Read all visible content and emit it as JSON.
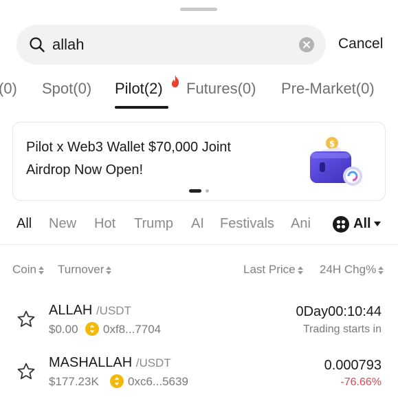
{
  "search": {
    "value": "allah",
    "cancel_label": "Cancel"
  },
  "tabs": [
    {
      "label": "(0)"
    },
    {
      "label": "Spot(0)"
    },
    {
      "label": "Pilot(2)",
      "active": true
    },
    {
      "label": "Futures(0)"
    },
    {
      "label": "Pre-Market(0)"
    }
  ],
  "banner": {
    "line1": "Pilot x Web3 Wallet $70,000 Joint",
    "line2": "Airdrop Now Open!"
  },
  "filters": {
    "items": [
      "All",
      "New",
      "Hot",
      "Trump",
      "AI",
      "Festivals",
      "Ani"
    ],
    "dropdown_label": "All"
  },
  "table": {
    "headers": {
      "coin": "Coin",
      "turnover": "Turnover",
      "last_price": "Last Price",
      "change": "24H Chg%"
    },
    "rows": [
      {
        "name": "ALLAH",
        "pair": "/USDT",
        "turnover": "$0.00",
        "address": "0xf8...7704",
        "price": "0Day00:10:44",
        "sub": "Trading starts in"
      },
      {
        "name": "MASHALLAH",
        "pair": "/USDT",
        "turnover": "$177.23K",
        "address": "0xc6...5639",
        "price": "0.000793",
        "sub": "-76.66%"
      }
    ]
  },
  "colors": {
    "negative": "#e0454f",
    "accent_flame": "#e8412c",
    "bnb_yellow": "#f0b90b"
  },
  "icons": [
    "search-icon",
    "clear-icon",
    "flame-icon",
    "wallet-icon",
    "grid-icon",
    "caret-down-icon",
    "sort-icon",
    "star-icon",
    "bnb-chain-icon"
  ]
}
